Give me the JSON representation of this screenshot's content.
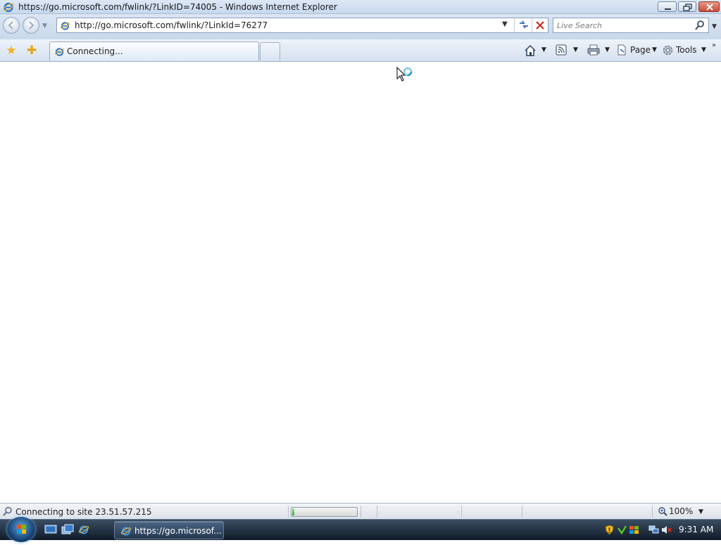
{
  "window": {
    "title": "https://go.microsoft.com/fwlink/?LinkID=74005 - Windows Internet Explorer"
  },
  "address_bar": {
    "url": "http://go.microsoft.com/fwlink/?LinkId=76277"
  },
  "search": {
    "placeholder": "Live Search"
  },
  "tab": {
    "label": "Connecting..."
  },
  "command_bar": {
    "page_label": "Page",
    "tools_label": "Tools"
  },
  "status_bar": {
    "text": "Connecting to site 23.51.57.215",
    "progress_fraction": 0.03,
    "zoom": "100%"
  },
  "taskbar": {
    "window_button": "https://go.microsof...",
    "clock": "9:31 AM"
  },
  "colors": {
    "chrome_blue": "#c9d8ea",
    "taskbar": "#1b2838",
    "progress_green": "#2fa62a",
    "stop_red": "#d42c1a"
  }
}
